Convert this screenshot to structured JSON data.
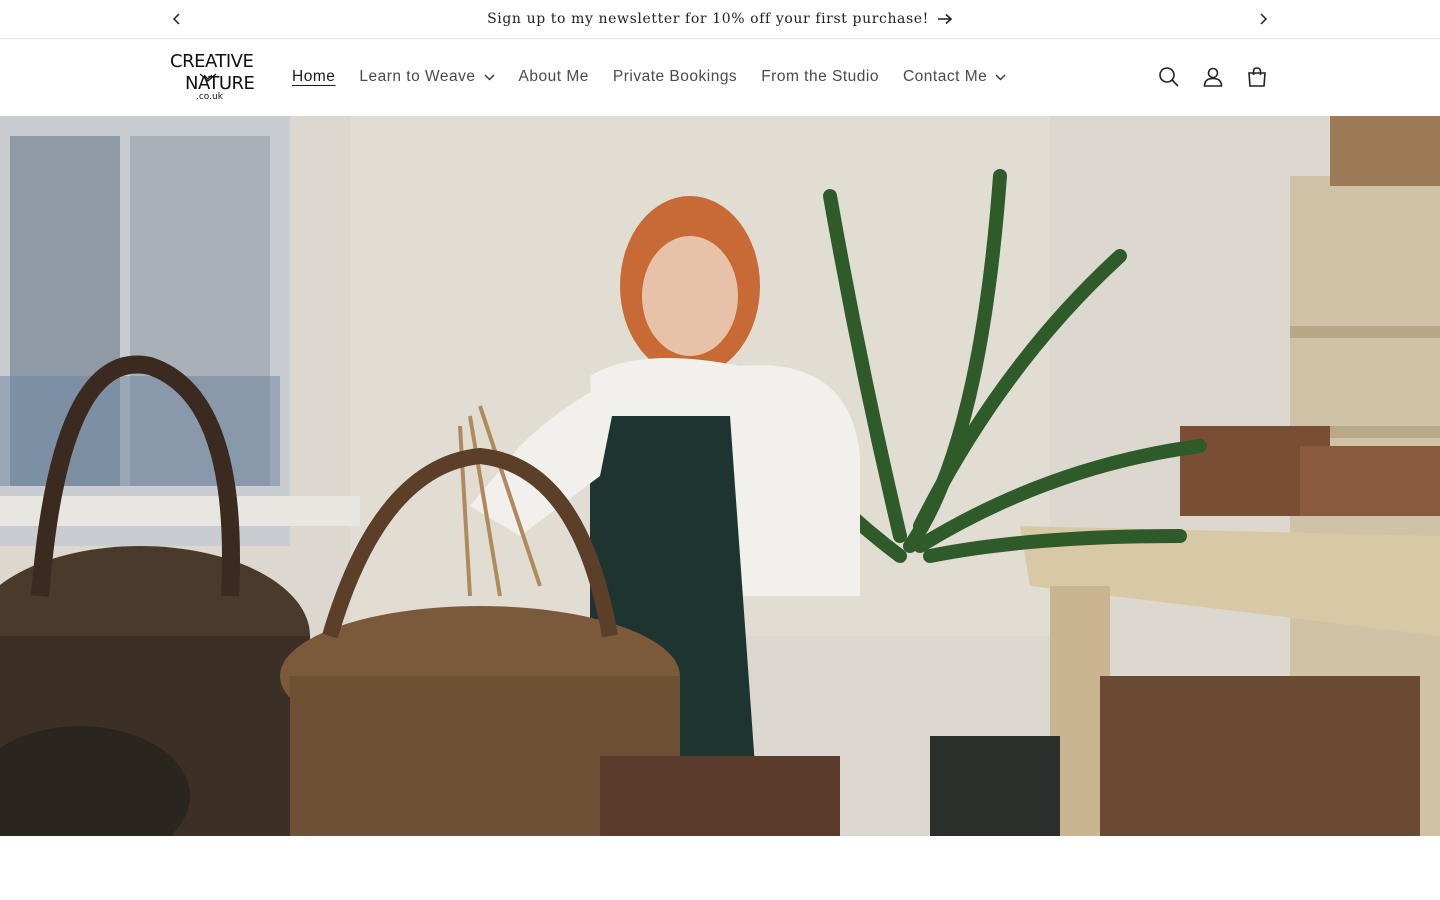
{
  "announcement": {
    "text": "Sign up to my newsletter for 10% off your first purchase!"
  },
  "logo": {
    "line1": "CREATIVE",
    "line2": "NATURE",
    "line3": ".co.uk"
  },
  "nav": {
    "items": [
      {
        "label": "Home",
        "active": true,
        "dropdown": false
      },
      {
        "label": "Learn to Weave",
        "active": false,
        "dropdown": true
      },
      {
        "label": "About Me",
        "active": false,
        "dropdown": false
      },
      {
        "label": "Private Bookings",
        "active": false,
        "dropdown": false
      },
      {
        "label": "From the Studio",
        "active": false,
        "dropdown": false
      },
      {
        "label": "Contact Me",
        "active": false,
        "dropdown": true
      }
    ]
  },
  "header_icons": [
    "search-icon",
    "account-icon",
    "cart-icon"
  ],
  "colors": {
    "text": "#121212",
    "nav_text": "#4a4a4a",
    "divider": "#e6e6e6",
    "background": "#ffffff"
  }
}
